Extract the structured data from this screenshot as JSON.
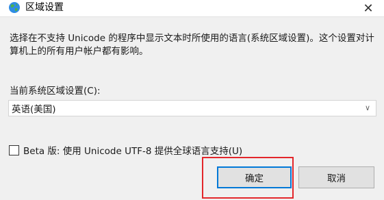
{
  "window": {
    "title": "区域设置",
    "close_symbol": "✕"
  },
  "content": {
    "description": "选择在不支持 Unicode 的程序中显示文本时所使用的语言(系统区域设置)。这个设置对计算机上的所有用户帐户都有影响。",
    "current_label": "当前系统区域设置(C):",
    "current_value": "英语(美国)",
    "beta_label": "Beta 版: 使用 Unicode UTF-8 提供全球语言支持(U)",
    "beta_checked": false
  },
  "buttons": {
    "ok": "确定",
    "cancel": "取消"
  },
  "colors": {
    "highlight": "#e3262a",
    "accent": "#0078d7"
  }
}
